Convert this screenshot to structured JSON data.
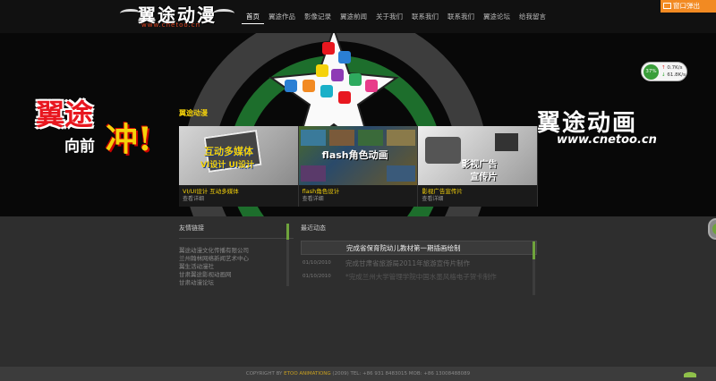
{
  "header": {
    "logo_title": "翼途动漫",
    "logo_sub": "www.cnetoo.cn",
    "nav": [
      "首页",
      "翼途作品",
      "影像记录",
      "翼途前闻",
      "关于我们",
      "联系我们",
      "联系我们",
      "翼途论坛",
      "给我留言"
    ],
    "active_nav_index": 0,
    "popout_label": "窗口弹出"
  },
  "speed_widget": {
    "percent": "37%",
    "upload": "0.7K/s",
    "download": "61.8K/s"
  },
  "banner": {
    "slogan_line1": "翼途",
    "slogan_line2": "向前",
    "slogan_line3": "冲",
    "slogan_punct": "!",
    "brand_right": "翼途动画",
    "brand_right_sub": "www.cnetoo.cn",
    "section_label": "翼途动漫",
    "tiles": [
      {
        "overlay1": "互动多媒体",
        "overlay2": "VI设计 UI设计",
        "title": "VI/UI设计 互动多媒体",
        "sub": "查看详细"
      },
      {
        "overlay1": "flash角色动画",
        "overlay2": "",
        "title": "flash角色设计",
        "sub": "查看详细"
      },
      {
        "overlay1": "影视广告",
        "overlay2": "宣传片",
        "title": "影视广告宣传片",
        "sub": "查看详细"
      }
    ]
  },
  "links": {
    "heading": "友情链接",
    "items": [
      "翼途动漫文化传播有限公司",
      "兰州翰林网络新闻艺术中心",
      "翼生活动漫社",
      "甘肃翼途影视动画网",
      "甘肃动漫论坛"
    ]
  },
  "news": {
    "heading": "最近动态",
    "items": [
      {
        "date": "",
        "title": "完成省保育院幼儿教材第一期插画绘制"
      },
      {
        "date": "01/10/2010",
        "title": "完成甘肃省旅游局2011年旅游宣传片制作"
      },
      {
        "date": "01/10/2010",
        "title": "*完成兰州大学管理学院中国水墨风格电子贺卡制作"
      }
    ]
  },
  "footer": {
    "copyright_prefix": "COPYRIGHT BY",
    "brand": "ETOO ANIMATIONG",
    "rest": "(2009)  TEL: +86 931 8483015  MOB: +86 13008488089"
  },
  "colors": {
    "accent_orange": "#f28a22",
    "accent_yellow": "#f5d20a",
    "accent_green": "#6fa33c",
    "brand_red": "#e8171f"
  }
}
